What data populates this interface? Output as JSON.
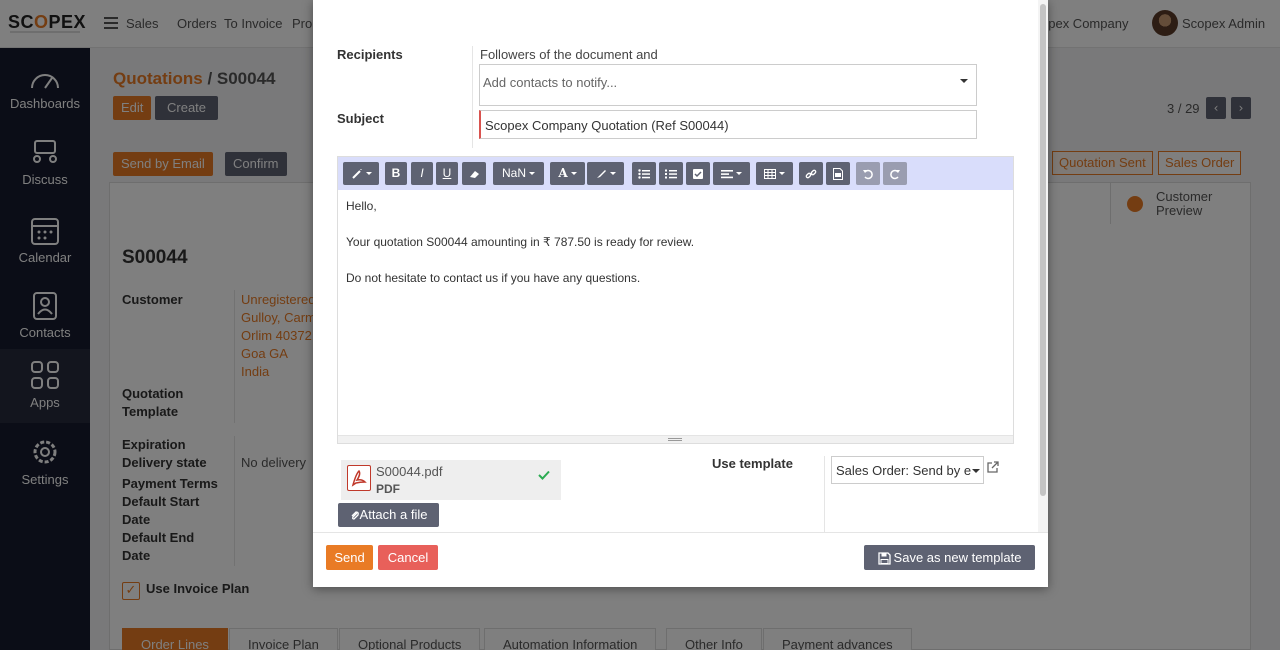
{
  "app": {
    "logo_text": "SCOPEX",
    "nav": {
      "menu": "Sales",
      "items": [
        "Orders",
        "To Invoice",
        "Pro"
      ]
    },
    "company": "opex Company",
    "user": "Scopex Admin"
  },
  "sidebar": {
    "items": [
      {
        "label": "Dashboards",
        "icon": "gauge-icon"
      },
      {
        "label": "Discuss",
        "icon": "discuss-icon"
      },
      {
        "label": "Calendar",
        "icon": "calendar-icon"
      },
      {
        "label": "Contacts",
        "icon": "contacts-icon"
      },
      {
        "label": "Apps",
        "icon": "apps-grid-icon"
      },
      {
        "label": "Settings",
        "icon": "gear-icon"
      }
    ]
  },
  "record": {
    "breadcrumb_parent": "Quotations",
    "breadcrumb_sep": " / ",
    "breadcrumb_current": "S00044",
    "edit": "Edit",
    "create": "Create",
    "pager": "3 / 29",
    "send_by_email": "Send by Email",
    "confirm": "Confirm",
    "status_sent": "Quotation Sent",
    "status_order": "Sales Order",
    "customer_preview_line1": "Customer",
    "customer_preview_line2": "Preview",
    "name": "S00044",
    "customer_label": "Customer",
    "customer_lines": [
      "Unregistered",
      "Gulloy, Carm",
      "Orlim 40372",
      "Goa GA",
      "India"
    ],
    "quotation_template_label_1": "Quotation",
    "quotation_template_label_2": "Template",
    "expiration_label": "Expiration",
    "delivery_state_label": "Delivery state",
    "delivery_state_value": "No delivery",
    "payment_terms_label": "Payment Terms",
    "default_start_1": "Default Start",
    "default_start_2": "Date",
    "default_end_1": "Default End",
    "default_end_2": "Date",
    "use_invoice_plan": "Use Invoice Plan",
    "tabs": [
      "Order Lines",
      "Invoice Plan",
      "Optional Products",
      "Automation Information",
      "Other Info",
      "Payment advances"
    ]
  },
  "composer": {
    "recipients_label": "Recipients",
    "followers_text": "Followers of the document and",
    "contacts_placeholder": "Add contacts to notify...",
    "subject_label": "Subject",
    "subject_value": "Scopex Company Quotation (Ref S00044)",
    "toolbar": {
      "font_size": "NaN",
      "bold": "B",
      "italic": "I",
      "underline": "U"
    },
    "body": {
      "line1": "Hello,",
      "line2": "Your quotation S00044 amounting in ₹ 787.50 is ready for review.",
      "line3": "Do not hesitate to contact us if you have any questions."
    },
    "attachment": {
      "name": "S00044.pdf",
      "type": "PDF"
    },
    "attach_button": "Attach a file",
    "use_template_label": "Use template",
    "template_value": "Sales Order: Send by email",
    "send": "Send",
    "cancel": "Cancel",
    "save_template": "Save as new template"
  },
  "colors": {
    "accent": "#e97b25",
    "slate": "#5e6272",
    "danger": "#e8605a",
    "sidebar": "#171b2e"
  }
}
